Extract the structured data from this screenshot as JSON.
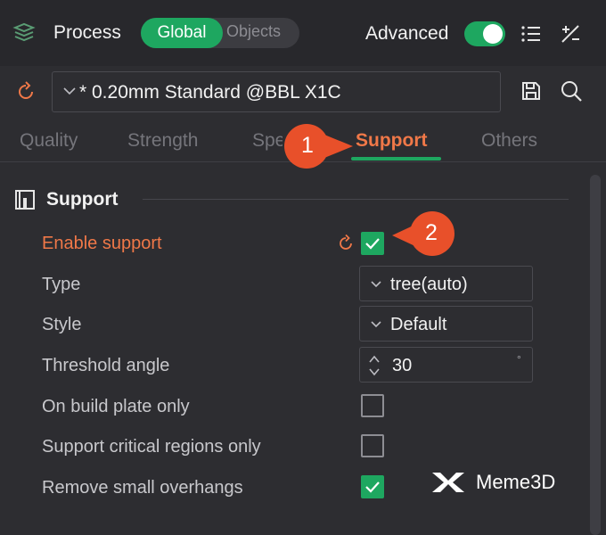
{
  "header": {
    "title": "Process",
    "mode_options": [
      "Global",
      "Objects"
    ],
    "mode_selected": "Global",
    "advanced_label": "Advanced",
    "advanced_on": true
  },
  "preset": {
    "value": "* 0.20mm Standard @BBL X1C"
  },
  "tabs": [
    "Quality",
    "Strength",
    "Speed",
    "Support",
    "Others"
  ],
  "active_tab": "Support",
  "callouts": [
    "1",
    "2"
  ],
  "section": {
    "title": "Support",
    "rows": [
      {
        "label": "Enable support",
        "control": "checkbox",
        "checked": true,
        "modified": true
      },
      {
        "label": "Type",
        "control": "select",
        "value": "tree(auto)"
      },
      {
        "label": "Style",
        "control": "select",
        "value": "Default"
      },
      {
        "label": "Threshold angle",
        "control": "spin",
        "value": "30",
        "unit": "°"
      },
      {
        "label": "On build plate only",
        "control": "checkbox",
        "checked": false
      },
      {
        "label": "Support critical regions only",
        "control": "checkbox",
        "checked": false
      },
      {
        "label": "Remove small overhangs",
        "control": "checkbox",
        "checked": true
      }
    ]
  },
  "watermark": {
    "text": "Meme3D"
  },
  "colors": {
    "accent_green": "#1ea760",
    "accent_orange": "#f07848",
    "callout_red": "#e8502a",
    "background": "#2d2d31"
  },
  "icons": [
    "layers-icon",
    "list-icon",
    "compare-icon",
    "reset-icon",
    "chevron-down-icon",
    "save-icon",
    "search-icon",
    "section-icon",
    "checkmark-icon",
    "spin-arrows-icon",
    "logo-icon"
  ]
}
